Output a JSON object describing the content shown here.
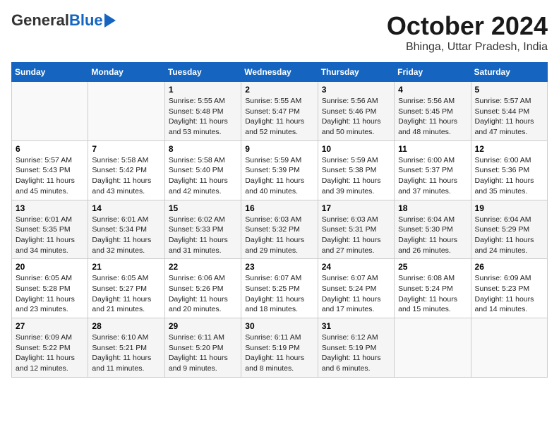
{
  "header": {
    "logo_general": "General",
    "logo_blue": "Blue",
    "title": "October 2024",
    "subtitle": "Bhinga, Uttar Pradesh, India"
  },
  "calendar": {
    "days_of_week": [
      "Sunday",
      "Monday",
      "Tuesday",
      "Wednesday",
      "Thursday",
      "Friday",
      "Saturday"
    ],
    "weeks": [
      [
        {
          "day": "",
          "info": ""
        },
        {
          "day": "",
          "info": ""
        },
        {
          "day": "1",
          "info": "Sunrise: 5:55 AM\nSunset: 5:48 PM\nDaylight: 11 hours and 53 minutes."
        },
        {
          "day": "2",
          "info": "Sunrise: 5:55 AM\nSunset: 5:47 PM\nDaylight: 11 hours and 52 minutes."
        },
        {
          "day": "3",
          "info": "Sunrise: 5:56 AM\nSunset: 5:46 PM\nDaylight: 11 hours and 50 minutes."
        },
        {
          "day": "4",
          "info": "Sunrise: 5:56 AM\nSunset: 5:45 PM\nDaylight: 11 hours and 48 minutes."
        },
        {
          "day": "5",
          "info": "Sunrise: 5:57 AM\nSunset: 5:44 PM\nDaylight: 11 hours and 47 minutes."
        }
      ],
      [
        {
          "day": "6",
          "info": "Sunrise: 5:57 AM\nSunset: 5:43 PM\nDaylight: 11 hours and 45 minutes."
        },
        {
          "day": "7",
          "info": "Sunrise: 5:58 AM\nSunset: 5:42 PM\nDaylight: 11 hours and 43 minutes."
        },
        {
          "day": "8",
          "info": "Sunrise: 5:58 AM\nSunset: 5:40 PM\nDaylight: 11 hours and 42 minutes."
        },
        {
          "day": "9",
          "info": "Sunrise: 5:59 AM\nSunset: 5:39 PM\nDaylight: 11 hours and 40 minutes."
        },
        {
          "day": "10",
          "info": "Sunrise: 5:59 AM\nSunset: 5:38 PM\nDaylight: 11 hours and 39 minutes."
        },
        {
          "day": "11",
          "info": "Sunrise: 6:00 AM\nSunset: 5:37 PM\nDaylight: 11 hours and 37 minutes."
        },
        {
          "day": "12",
          "info": "Sunrise: 6:00 AM\nSunset: 5:36 PM\nDaylight: 11 hours and 35 minutes."
        }
      ],
      [
        {
          "day": "13",
          "info": "Sunrise: 6:01 AM\nSunset: 5:35 PM\nDaylight: 11 hours and 34 minutes."
        },
        {
          "day": "14",
          "info": "Sunrise: 6:01 AM\nSunset: 5:34 PM\nDaylight: 11 hours and 32 minutes."
        },
        {
          "day": "15",
          "info": "Sunrise: 6:02 AM\nSunset: 5:33 PM\nDaylight: 11 hours and 31 minutes."
        },
        {
          "day": "16",
          "info": "Sunrise: 6:03 AM\nSunset: 5:32 PM\nDaylight: 11 hours and 29 minutes."
        },
        {
          "day": "17",
          "info": "Sunrise: 6:03 AM\nSunset: 5:31 PM\nDaylight: 11 hours and 27 minutes."
        },
        {
          "day": "18",
          "info": "Sunrise: 6:04 AM\nSunset: 5:30 PM\nDaylight: 11 hours and 26 minutes."
        },
        {
          "day": "19",
          "info": "Sunrise: 6:04 AM\nSunset: 5:29 PM\nDaylight: 11 hours and 24 minutes."
        }
      ],
      [
        {
          "day": "20",
          "info": "Sunrise: 6:05 AM\nSunset: 5:28 PM\nDaylight: 11 hours and 23 minutes."
        },
        {
          "day": "21",
          "info": "Sunrise: 6:05 AM\nSunset: 5:27 PM\nDaylight: 11 hours and 21 minutes."
        },
        {
          "day": "22",
          "info": "Sunrise: 6:06 AM\nSunset: 5:26 PM\nDaylight: 11 hours and 20 minutes."
        },
        {
          "day": "23",
          "info": "Sunrise: 6:07 AM\nSunset: 5:25 PM\nDaylight: 11 hours and 18 minutes."
        },
        {
          "day": "24",
          "info": "Sunrise: 6:07 AM\nSunset: 5:24 PM\nDaylight: 11 hours and 17 minutes."
        },
        {
          "day": "25",
          "info": "Sunrise: 6:08 AM\nSunset: 5:24 PM\nDaylight: 11 hours and 15 minutes."
        },
        {
          "day": "26",
          "info": "Sunrise: 6:09 AM\nSunset: 5:23 PM\nDaylight: 11 hours and 14 minutes."
        }
      ],
      [
        {
          "day": "27",
          "info": "Sunrise: 6:09 AM\nSunset: 5:22 PM\nDaylight: 11 hours and 12 minutes."
        },
        {
          "day": "28",
          "info": "Sunrise: 6:10 AM\nSunset: 5:21 PM\nDaylight: 11 hours and 11 minutes."
        },
        {
          "day": "29",
          "info": "Sunrise: 6:11 AM\nSunset: 5:20 PM\nDaylight: 11 hours and 9 minutes."
        },
        {
          "day": "30",
          "info": "Sunrise: 6:11 AM\nSunset: 5:19 PM\nDaylight: 11 hours and 8 minutes."
        },
        {
          "day": "31",
          "info": "Sunrise: 6:12 AM\nSunset: 5:19 PM\nDaylight: 11 hours and 6 minutes."
        },
        {
          "day": "",
          "info": ""
        },
        {
          "day": "",
          "info": ""
        }
      ]
    ]
  }
}
